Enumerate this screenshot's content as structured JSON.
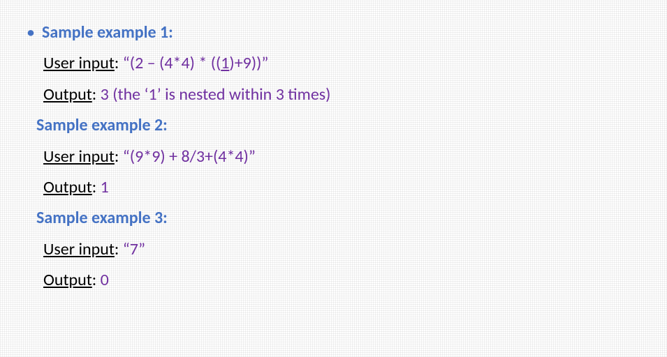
{
  "examples": [
    {
      "heading": "Sample example 1",
      "heading_colon": ":",
      "input_label": "User input",
      "input_colon": ": ",
      "input_value": "“(2 – (4*4) * ((",
      "input_underlined": "1",
      "input_value_tail": ")+9))”",
      "output_label": "Output",
      "output_colon": ": ",
      "output_num": "3",
      "output_note": " (the ‘1’ is nested within 3 times)"
    },
    {
      "heading": "Sample example 2",
      "heading_colon": ":",
      "input_label": "User input",
      "input_colon": ": ",
      "input_value": "“(9*9) + 8/3+(4*4)”",
      "output_label": "Output",
      "output_colon": ": ",
      "output_num": "1"
    },
    {
      "heading": "Sample example 3",
      "heading_colon": ":",
      "input_label": "User input",
      "input_colon": ": ",
      "input_value": "“7”",
      "output_label": "Output",
      "output_colon": ": ",
      "output_num": "0"
    }
  ]
}
